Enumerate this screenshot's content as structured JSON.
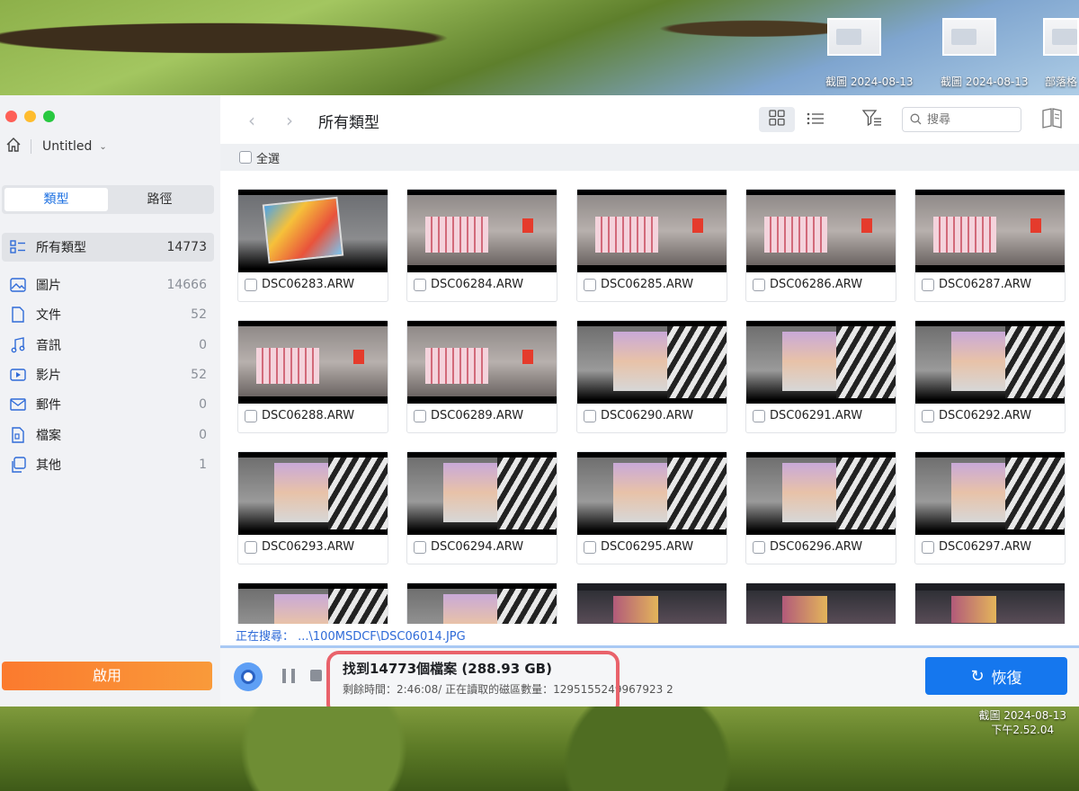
{
  "desktop": {
    "screenshots": [
      {
        "label": "截圖 2024-08-13"
      },
      {
        "label": "截圖 2024-08-13"
      },
      {
        "label": "部落格"
      }
    ],
    "corner_label_line1": "截圖 2024-08-13",
    "corner_label_line2": "下午2.52.04"
  },
  "sidebar": {
    "project_name": "Untitled",
    "tabs": [
      "類型",
      "路徑"
    ],
    "active_tab": "類型",
    "categories": [
      {
        "label": "所有類型",
        "count": "14773",
        "icon": "grid-list-icon"
      },
      {
        "label": "圖片",
        "count": "14666",
        "icon": "image-icon"
      },
      {
        "label": "文件",
        "count": "52",
        "icon": "document-icon"
      },
      {
        "label": "音訊",
        "count": "0",
        "icon": "music-note-icon"
      },
      {
        "label": "影片",
        "count": "52",
        "icon": "video-icon"
      },
      {
        "label": "郵件",
        "count": "0",
        "icon": "mail-icon"
      },
      {
        "label": "檔案",
        "count": "0",
        "icon": "archive-icon"
      },
      {
        "label": "其他",
        "count": "1",
        "icon": "other-file-icon"
      }
    ],
    "activate_label": "啟用"
  },
  "toolbar": {
    "title": "所有類型",
    "search_placeholder": "搜尋"
  },
  "select_all_label": "全選",
  "files": [
    {
      "name": "DSC06283.ARW"
    },
    {
      "name": "DSC06284.ARW"
    },
    {
      "name": "DSC06285.ARW"
    },
    {
      "name": "DSC06286.ARW"
    },
    {
      "name": "DSC06287.ARW"
    },
    {
      "name": "DSC06288.ARW"
    },
    {
      "name": "DSC06289.ARW"
    },
    {
      "name": "DSC06290.ARW"
    },
    {
      "name": "DSC06291.ARW"
    },
    {
      "name": "DSC06292.ARW"
    },
    {
      "name": "DSC06293.ARW"
    },
    {
      "name": "DSC06294.ARW"
    },
    {
      "name": "DSC06295.ARW"
    },
    {
      "name": "DSC06296.ARW"
    },
    {
      "name": "DSC06297.ARW"
    },
    {
      "name": ""
    },
    {
      "name": ""
    },
    {
      "name": ""
    },
    {
      "name": ""
    },
    {
      "name": ""
    }
  ],
  "status": {
    "searching": "正在搜尋： ...\\100MSDCF\\DSC06014.JPG",
    "found": "找到14773個檔案 (288.93 GB)",
    "remaining": "剩餘時間：2:46:08/ 正在讀取的磁區數量：1295155249967923 2"
  },
  "recover_label": "恢復",
  "colors": {
    "accent": "#1577ee",
    "activate": "#fb7a2e",
    "highlight": "#e9626b"
  }
}
